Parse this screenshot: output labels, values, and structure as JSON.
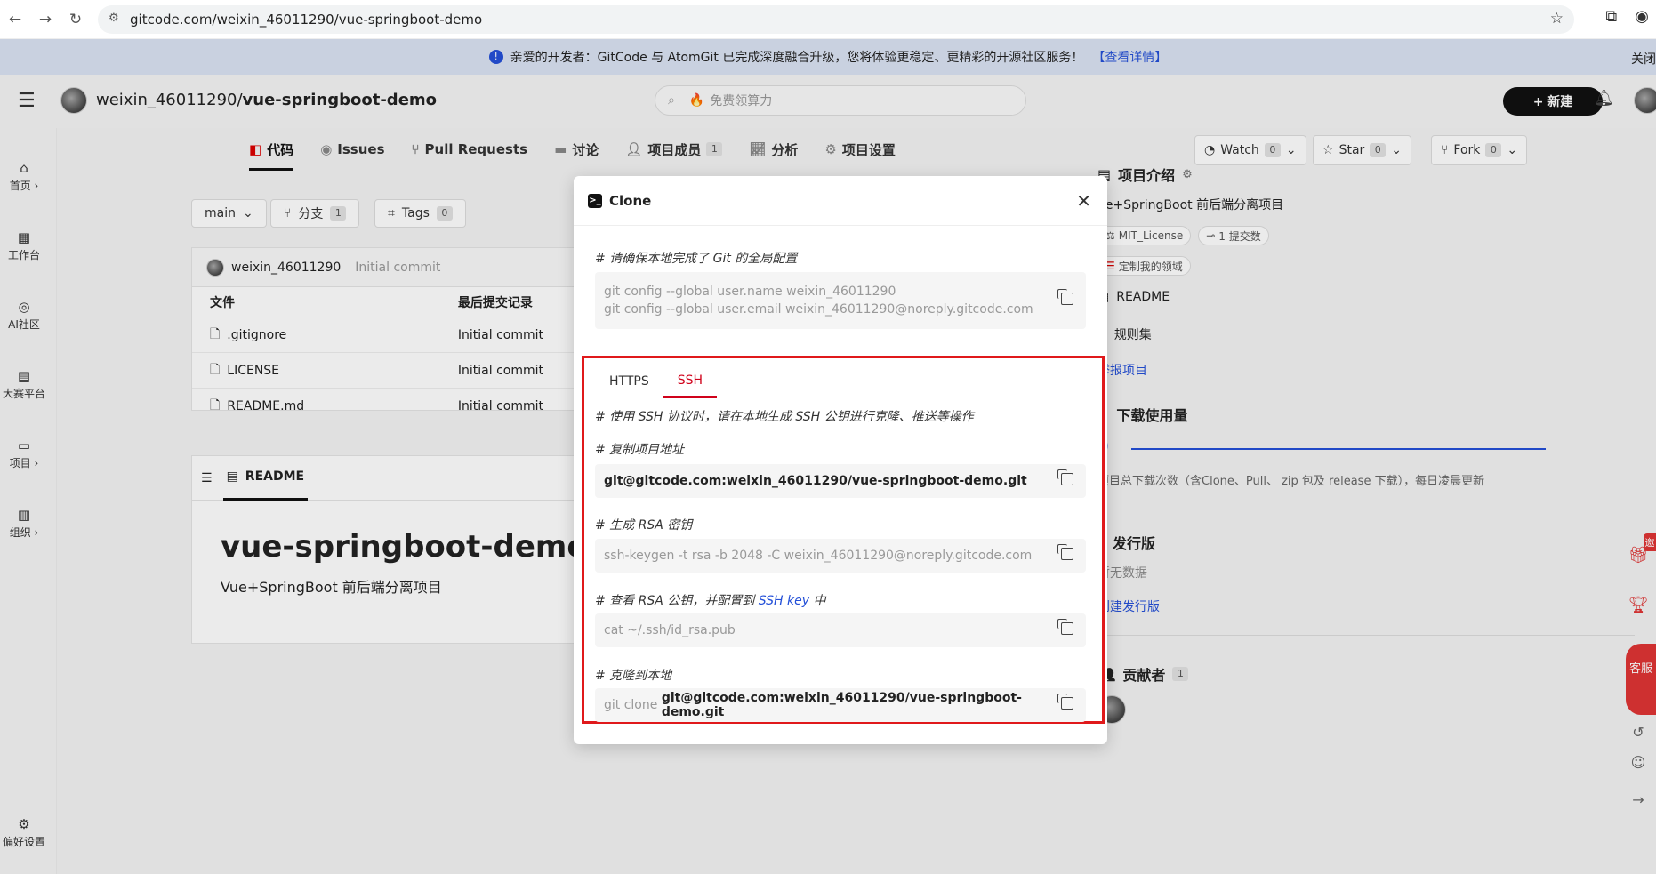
{
  "browser": {
    "url": "gitcode.com/weixin_46011290/vue-springboot-demo"
  },
  "notice": {
    "text": "亲爱的开发者：GitCode 与 AtomGit 已完成深度融合升级，您将体验更稳定、更精彩的开源社区服务！",
    "link": "【查看详情】",
    "close": "关闭"
  },
  "header": {
    "owner": "weixin_46011290/",
    "repo": "vue-springboot-demo",
    "search_placeholder": "免费领算力",
    "new_label": "+ 新建"
  },
  "sidebar": {
    "items": [
      {
        "label": "首页 ›"
      },
      {
        "label": "工作台"
      },
      {
        "label": "AI社区"
      },
      {
        "label": "大赛平台"
      },
      {
        "label": "项目 ›"
      },
      {
        "label": "组织 ›"
      },
      {
        "label": "偏好设置"
      }
    ]
  },
  "tabs": [
    {
      "label": "代码"
    },
    {
      "label": "Issues"
    },
    {
      "label": "Pull Requests"
    },
    {
      "label": "讨论"
    },
    {
      "label": "项目成员",
      "count": "1"
    },
    {
      "label": "分析"
    },
    {
      "label": "项目设置"
    }
  ],
  "social": {
    "watch": "Watch",
    "watch_count": "0",
    "star": "Star",
    "star_count": "0",
    "fork": "Fork",
    "fork_count": "0"
  },
  "branch": {
    "current": "main",
    "branches_label": "分支",
    "branches_count": "1",
    "tags_label": "Tags",
    "tags_count": "0"
  },
  "commit": {
    "author": "weixin_46011290",
    "message": "Initial commit"
  },
  "files": {
    "col_file": "文件",
    "col_commit": "最后提交记录",
    "rows": [
      {
        "name": ".gitignore",
        "commit": "Initial commit"
      },
      {
        "name": "LICENSE",
        "commit": "Initial commit"
      },
      {
        "name": "README.md",
        "commit": "Initial commit"
      }
    ]
  },
  "readme": {
    "tab": "README",
    "title": "vue-springboot-demo",
    "desc": "Vue+SpringBoot 前后端分离项目"
  },
  "right": {
    "intro_title": "项目介绍",
    "intro_desc": "ue+SpringBoot 前后端分离项目",
    "license": "MIT_License",
    "commits": "1 提交数",
    "domain": "定制我的领域",
    "readme": "README",
    "rules": "规则集",
    "report": "举报项目",
    "downloads_title": "下载使用量",
    "downloads_value": "0",
    "downloads_desc": "项目总下载次数（含Clone、Pull、 zip 包及 release 下载），每日凌晨更新",
    "release_title": "发行版",
    "release_empty": "暂无数据",
    "release_create": "创建发行版",
    "contrib_title": "贡献者",
    "contrib_count": "1"
  },
  "dialog": {
    "title": "Clone",
    "config_comment": "# 请确保本地完成了 Git 的全局配置",
    "config_line1": "git config --global user.name weixin_46011290",
    "config_line2": "git config --global user.email weixin_46011290@noreply.gitcode.com",
    "tab_https": "HTTPS",
    "tab_ssh": "SSH",
    "ssh_comment": "# 使用 SSH 协议时，请在本地生成 SSH 公钥进行克隆、推送等操作",
    "copy_addr_comment": "# 复制项目地址",
    "ssh_url": "git@gitcode.com:weixin_46011290/vue-springboot-demo.git",
    "rsa_comment": "# 生成 RSA 密钥",
    "keygen_cmd": "ssh-keygen -t rsa -b 2048 -C weixin_46011290@noreply.gitcode.com",
    "view_comment_prefix": "# 查看 RSA 公钥，并配置到 ",
    "view_comment_link": "SSH key",
    "view_comment_suffix": " 中",
    "cat_cmd": "cat ~/.ssh/id_rsa.pub",
    "clone_comment": "# 克隆到本地",
    "clone_prefix": "git clone ",
    "clone_url": "git@gitcode.com:weixin_46011290/vue-springboot-demo.git"
  },
  "float": {
    "kefu": "客服"
  }
}
